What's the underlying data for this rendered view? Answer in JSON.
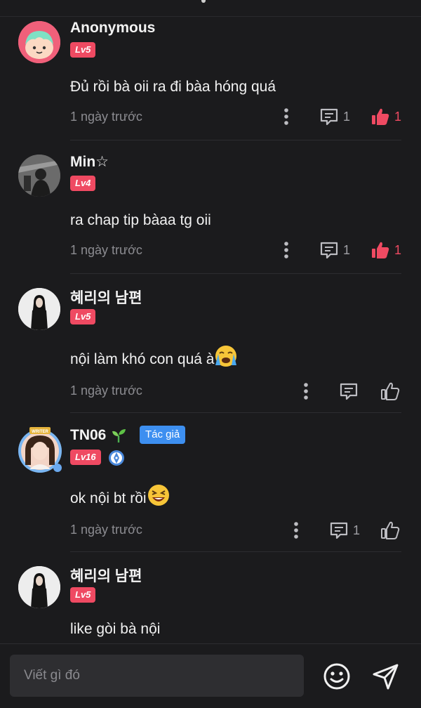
{
  "comments": [
    {
      "username": "Anonymous",
      "level": "Lv5",
      "text": "Đủ rồi bà oii ra đi bàa hóng quá",
      "time": "1 ngày trước",
      "replies": "1",
      "likes": "1",
      "liked": true
    },
    {
      "username": "Min☆",
      "level": "Lv4",
      "text": "ra chap tip bàaa tg oii",
      "time": "1 ngày trước",
      "replies": "1",
      "likes": "1",
      "liked": true
    },
    {
      "username": "혜리의 남편",
      "level": "Lv5",
      "text": "nội làm khó con quá à",
      "emoji": "loudly-crying-face",
      "time": "1 ngày trước",
      "replies": "",
      "likes": "",
      "liked": false
    },
    {
      "username": "TN06",
      "name_emoji": "seedling",
      "author_tag": "Tác giả",
      "avatar_frame_text": "WRITER",
      "level": "Lv16",
      "role_icon": "writer-pen-icon",
      "text": "ok nội bt rồi",
      "emoji": "laughing-face",
      "time": "1 ngày trước",
      "replies": "1",
      "likes": "",
      "liked": false
    },
    {
      "username": "혜리의 남편",
      "level": "Lv5",
      "text": "like gòi bà nội"
    }
  ],
  "composer": {
    "placeholder": "Viết gì đó",
    "emoji_icon": "smiley-icon",
    "send_icon": "send-icon"
  },
  "colors": {
    "background": "#1b1b1d",
    "accent_red": "#ef4a62",
    "author_blue": "#3d8ff0",
    "muted_text": "#8c8c91"
  }
}
